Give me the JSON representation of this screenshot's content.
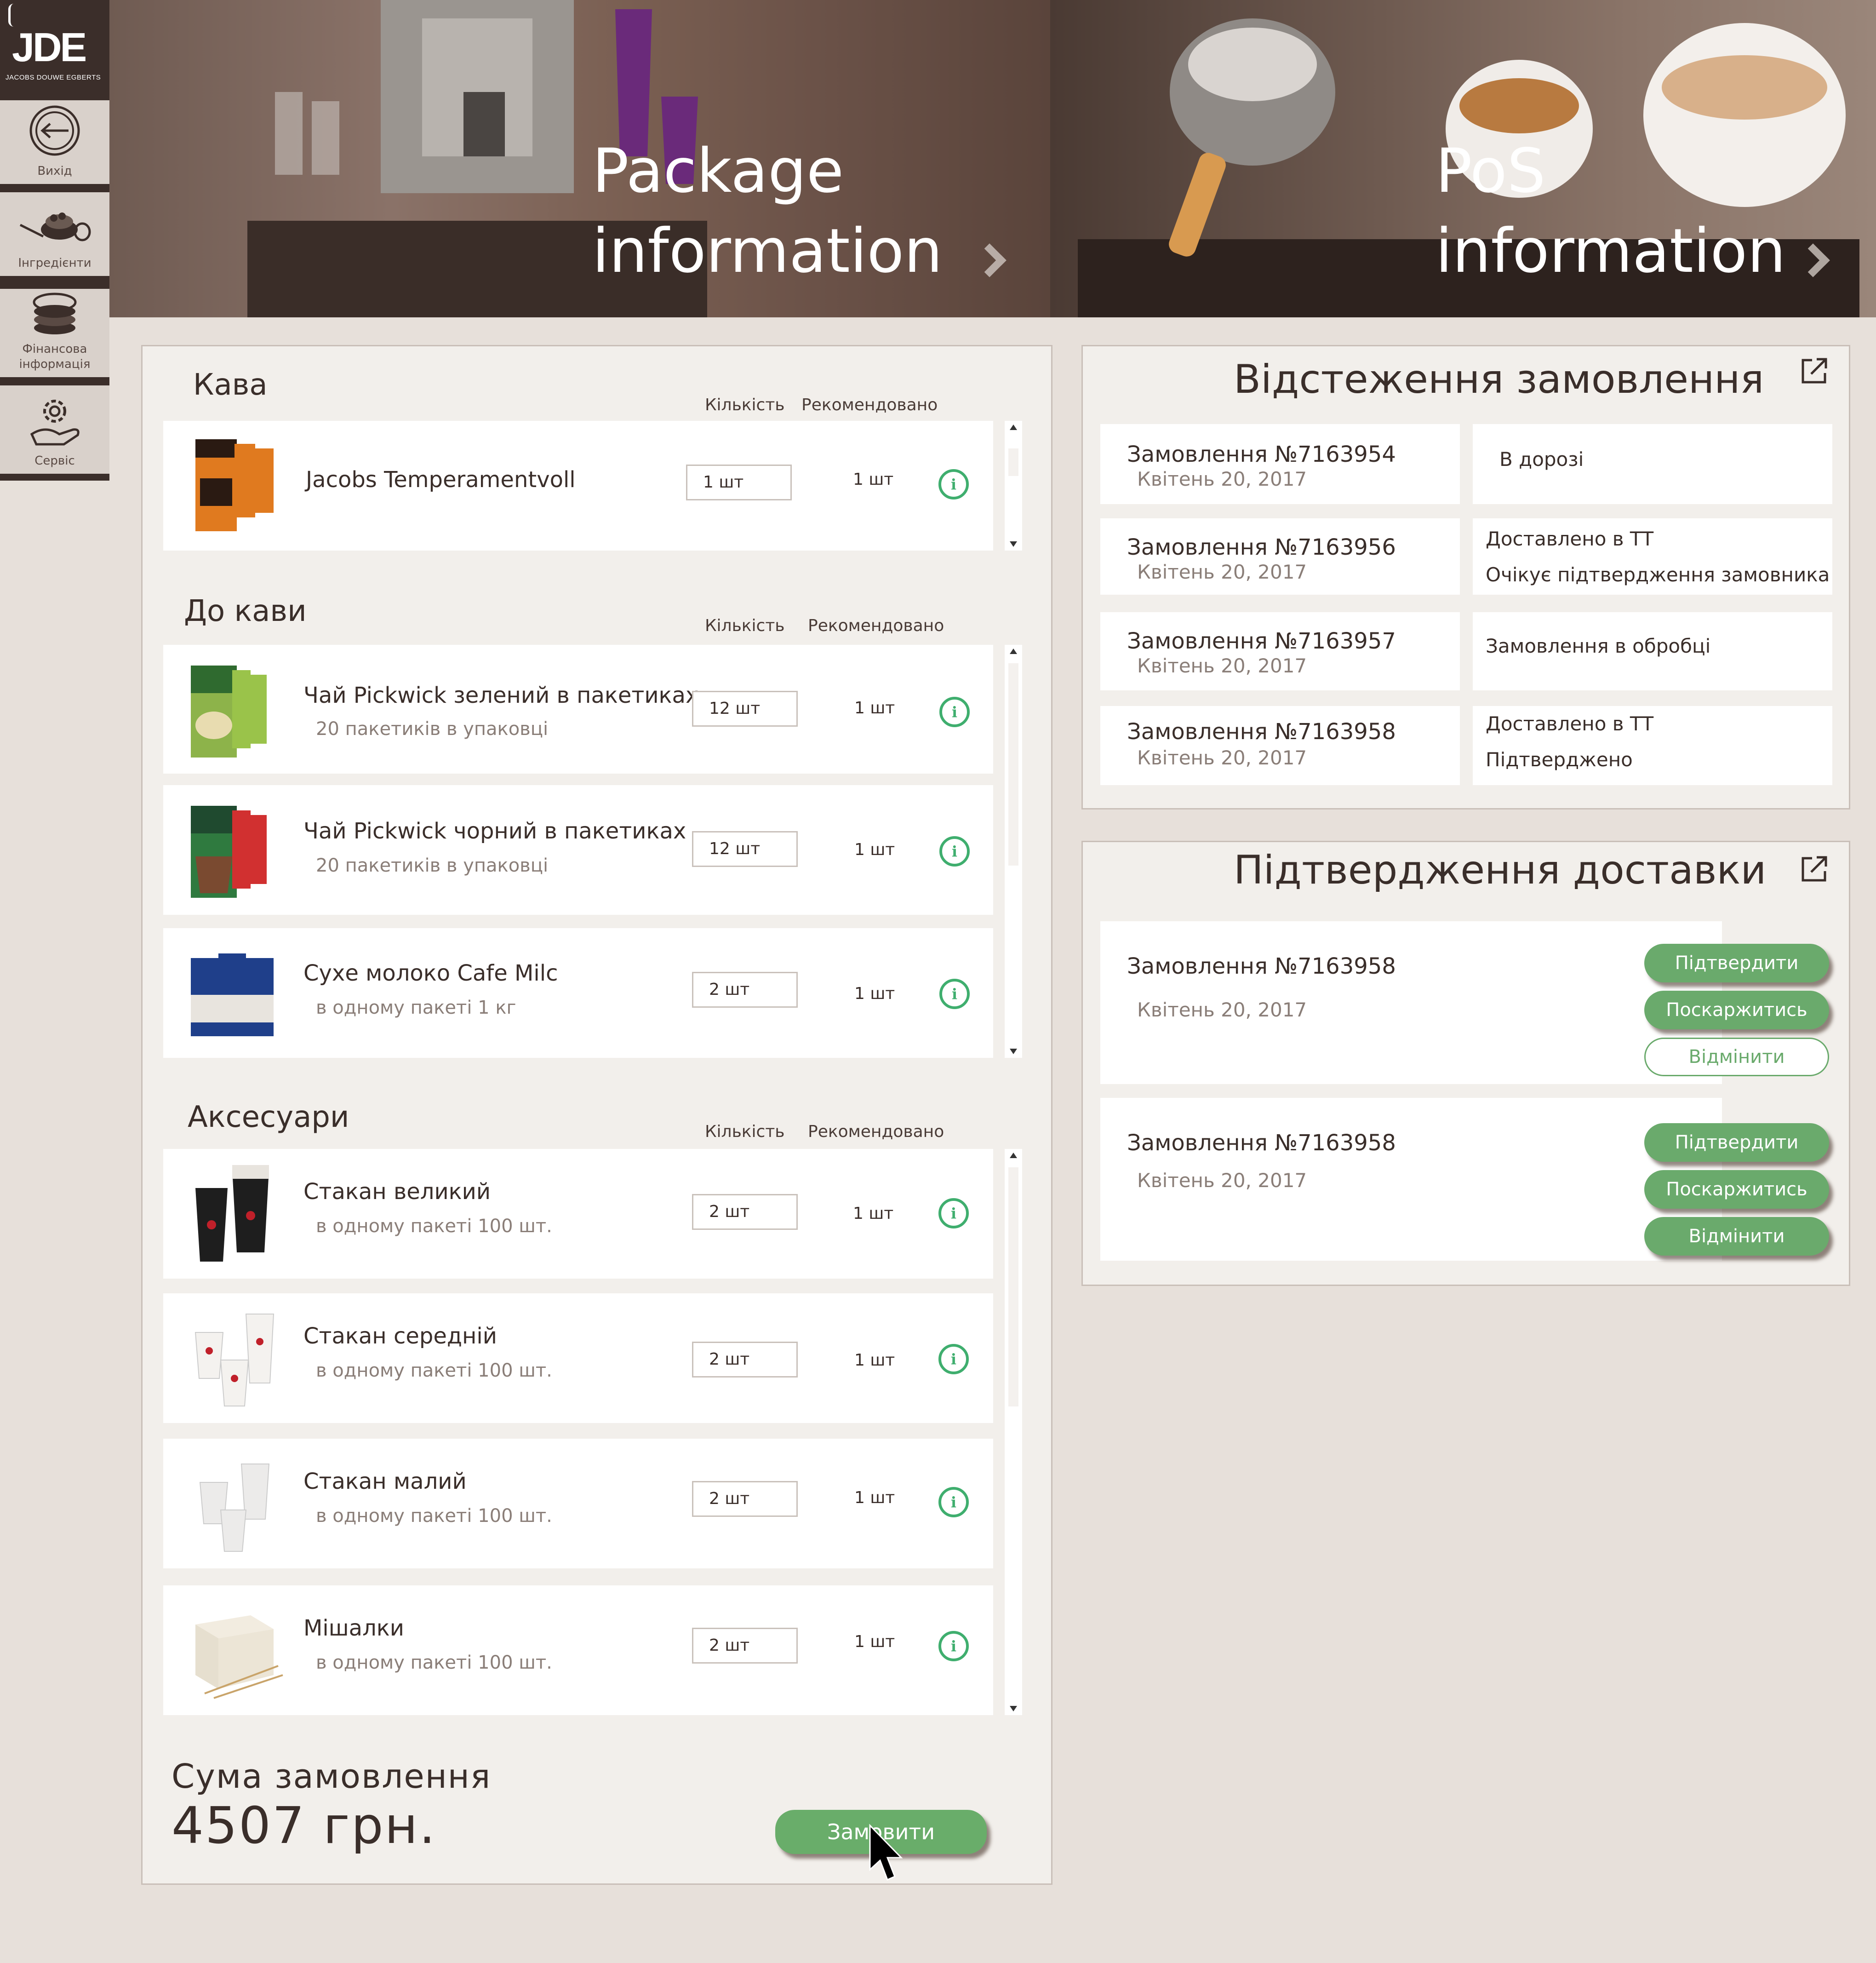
{
  "logo": {
    "brand": "JDE",
    "sub": "JACOBS DOUWE EGBERTS"
  },
  "sidebar": {
    "items": [
      {
        "label": "Вихід",
        "icon": "exit-icon"
      },
      {
        "label": "Інгредієнти",
        "icon": "ingredients-icon"
      },
      {
        "label": "Фінансова інформація",
        "icon": "finance-coins-icon"
      },
      {
        "label": "Сервіс",
        "icon": "service-gear-icon"
      }
    ]
  },
  "banners": {
    "package": {
      "line1": "Package",
      "line2": "information"
    },
    "pos": {
      "line1": "PoS",
      "line2": "information"
    }
  },
  "order": {
    "coffee": {
      "title": "Кава",
      "col_qty": "Кількість",
      "col_rec": "Рекомендовано",
      "items": [
        {
          "name": "Jacobs Temperamentvoll",
          "sub": "",
          "qty": "1 шт",
          "rec": "1 шт"
        }
      ]
    },
    "for_coffee": {
      "title": "До кави",
      "col_qty": "Кількість",
      "col_rec": "Рекомендовано",
      "items": [
        {
          "name": "Чай Pickwick зелений в пакетиках",
          "sub": "20 пакетиків в упаковці",
          "qty": "12 шт",
          "rec": "1 шт"
        },
        {
          "name": "Чай Pickwick чорний в пакетиках",
          "sub": "20 пакетиків в упаковці",
          "qty": "12 шт",
          "rec": "1 шт"
        },
        {
          "name": "Сухе молоко   Cafe Milc",
          "sub": "в одному пакеті 1 кг",
          "qty": "2 шт",
          "rec": "1 шт"
        }
      ]
    },
    "accessories": {
      "title": "Аксесуари",
      "col_qty": "Кількість",
      "col_rec": "Рекомендовано",
      "items": [
        {
          "name": "Стакан великий",
          "sub": "в одному пакеті 100 шт.",
          "qty": "2 шт",
          "rec": "1 шт"
        },
        {
          "name": "Стакан середній",
          "sub": "в одному пакеті 100 шт.",
          "qty": "2 шт",
          "rec": "1 шт"
        },
        {
          "name": "Стакан малий",
          "sub": "в одному пакеті 100 шт.",
          "qty": "2 шт",
          "rec": "1 шт"
        },
        {
          "name": "Мішалки",
          "sub": "в одному пакеті 100 шт.",
          "qty": "2 шт",
          "rec": "1 шт"
        }
      ]
    },
    "sum_label": "Сума замовлення",
    "sum_value": "4507 грн.",
    "order_button": "Замовити"
  },
  "tracking": {
    "title": "Відстеження замовлення",
    "orders": [
      {
        "number": "Замовлення №7163954",
        "date": "Квітень 20, 2017",
        "status1": "В дорозі",
        "status2": ""
      },
      {
        "number": "Замовлення №7163956",
        "date": "Квітень 20, 2017",
        "status1": "Доставлено в ТТ",
        "status2": "Очікує підтвердження замовника"
      },
      {
        "number": "Замовлення №7163957",
        "date": "Квітень 20, 2017",
        "status1": "Замовлення в обробці",
        "status2": ""
      },
      {
        "number": "Замовлення №7163958",
        "date": "Квітень 20, 2017",
        "status1": "Доставлено в ТТ",
        "status2": "Підтверджено"
      }
    ]
  },
  "delivery": {
    "title": "Підтвердження доставки",
    "orders": [
      {
        "number": "Замовлення №7163958",
        "date": "Квітень 20, 2017",
        "confirm": "Підтвердити",
        "complain": "Поскаржитись",
        "cancel": "Відмінити"
      },
      {
        "number": "Замовлення №7163958",
        "date": "Квітень 20, 2017",
        "confirm": "Підтвердити",
        "complain": "Поскаржитись",
        "cancel": "Відмінити"
      }
    ]
  },
  "colors": {
    "accent_green": "#6aaa6c",
    "info_green": "#3fae6e",
    "brand_brown": "#3b2e2a",
    "background": "#e7e0da"
  }
}
